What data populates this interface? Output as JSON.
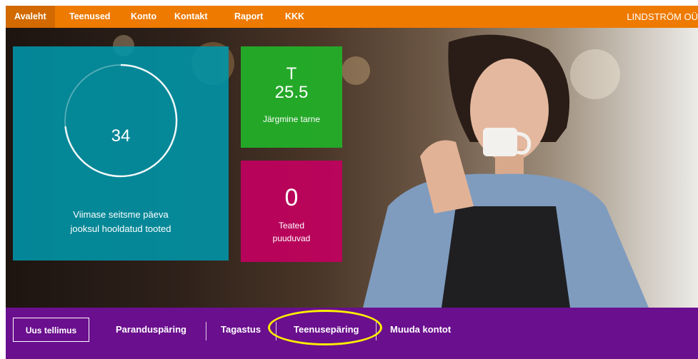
{
  "nav": {
    "items": [
      {
        "label": "Avaleht"
      },
      {
        "label": "Teenused"
      },
      {
        "label": "Konto"
      },
      {
        "label": "Kontakt"
      },
      {
        "label": "Raport"
      },
      {
        "label": "KKK"
      }
    ],
    "company": "LINDSTRÖM OÜ"
  },
  "tiles": {
    "serviced": {
      "value": "34",
      "caption_line1": "Viimase seitsme päeva",
      "caption_line2": "jooksul hooldatud tooted"
    },
    "delivery": {
      "day_letter": "T",
      "date": "25.5",
      "caption": "Järgmine tarne"
    },
    "notifications": {
      "count": "0",
      "caption_line1": "Teated",
      "caption_line2": "puuduvad"
    }
  },
  "actions": {
    "new_order": "Uus tellimus",
    "repair_request": "Paranduspäring",
    "return": "Tagastus",
    "service_request": "Teenusepäring",
    "change_account": "Muuda kontot"
  },
  "colors": {
    "nav_bg": "#ee7a00",
    "teal_tile": "#0096aa",
    "green_tile": "#22b228",
    "magenta_tile": "#c40060",
    "action_bar": "#6a0f8e",
    "highlight": "#ffee00"
  }
}
